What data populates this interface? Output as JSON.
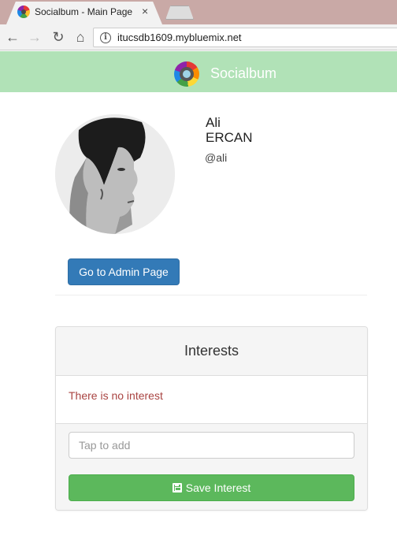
{
  "browser": {
    "tab_title": "Socialbum - Main Page",
    "tab_close": "×",
    "url": "itucsdb1609.mybluemix.net",
    "back": "←",
    "forward": "→",
    "reload": "↻",
    "home": "⌂",
    "info": "i"
  },
  "navbar": {
    "brand": "Socialbum"
  },
  "profile": {
    "first_name": "Ali",
    "last_name": "ERCAN",
    "handle": "@ali",
    "admin_button": "Go to Admin Page"
  },
  "interests": {
    "title": "Interests",
    "empty_text": "There is no interest",
    "input_placeholder": "Tap to add",
    "save_button": "Save Interest"
  },
  "colors": {
    "navbar": "#b1e2b7",
    "primary": "#337ab7",
    "success": "#5cb85c",
    "danger_text": "#a94442"
  }
}
